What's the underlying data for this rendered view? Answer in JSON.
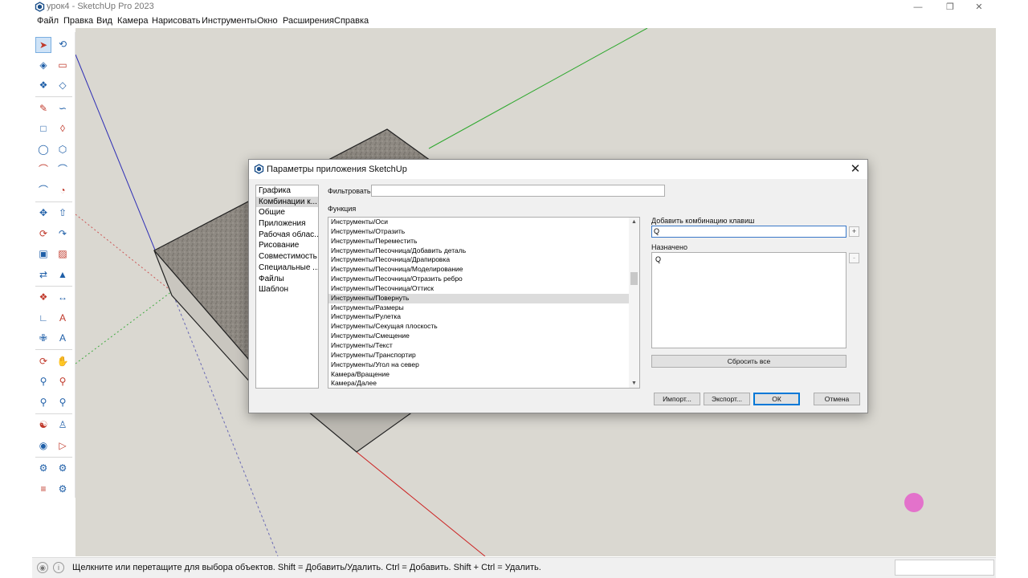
{
  "window": {
    "title": "урок4 - SketchUp Pro 2023",
    "icon": "sketchup-logo-icon",
    "controls": [
      "minimize-icon",
      "restore-icon",
      "close-icon"
    ]
  },
  "menu": [
    "Файл",
    "Правка",
    "Вид",
    "Камера",
    "Нарисовать",
    "Инструменты",
    "Окно",
    "Расширения",
    "Справка"
  ],
  "toolbar": {
    "tools": [
      "select-icon",
      "lasso-icon",
      "paint-bucket-icon",
      "eraser-icon",
      "make-component-icon",
      "tag-icon",
      "pencil-icon",
      "freehand-icon",
      "rectangle-icon",
      "rotated-rectangle-icon",
      "circle-icon",
      "polygon-icon",
      "arc-icon",
      "two-point-arc-icon",
      "three-point-arc-icon",
      "pie-icon",
      "move-icon",
      "push-pull-icon",
      "rotate-icon",
      "follow-me-icon",
      "scale-icon",
      "offset-icon",
      "flip-icon",
      "solid-tools-icon",
      "tape-measure-icon",
      "dimension-icon",
      "protractor-icon",
      "text-icon",
      "axes-icon",
      "3d-text-icon",
      "orbit-icon",
      "pan-icon",
      "zoom-icon",
      "zoom-window-icon",
      "zoom-extents-icon",
      "previous-view-icon",
      "position-camera-icon",
      "walk-icon",
      "look-around-icon",
      "section-plane-icon",
      "warehouse-icon",
      "extension-warehouse-icon",
      "layout-icon",
      "extension-manager-icon"
    ]
  },
  "status": {
    "hint": "Щелкните или перетащите для выбора объектов. Shift = Добавить/Удалить. Ctrl = Добавить. Shift + Ctrl = Удалить."
  },
  "dialog": {
    "title": "Параметры приложения SketchUp",
    "categories": [
      "Графика",
      "Комбинации к...",
      "Общие",
      "Приложения",
      "Рабочая облас...",
      "Рисование",
      "Совместимость",
      "Специальные ...",
      "Файлы",
      "Шаблон"
    ],
    "selected_category": "Комбинации к...",
    "filter_label": "Фильтровать",
    "filter_value": "",
    "function_label": "Функция",
    "functions": [
      "Инструменты/Оси",
      "Инструменты/Отразить",
      "Инструменты/Переместить",
      "Инструменты/Песочница/Добавить деталь",
      "Инструменты/Песочница/Драпировка",
      "Инструменты/Песочница/Моделирование",
      "Инструменты/Песочница/Отразить ребро",
      "Инструменты/Песочница/Оттиск",
      "Инструменты/Повернуть",
      "Инструменты/Размеры",
      "Инструменты/Рулетка",
      "Инструменты/Секущая плоскость",
      "Инструменты/Смещение",
      "Инструменты/Текст",
      "Инструменты/Транспортир",
      "Инструменты/Угол на север",
      "Камера/Вращение",
      "Камера/Далее"
    ],
    "selected_function": "Инструменты/Повернуть",
    "add_shortcut_label": "Добавить комбинацию клавиш",
    "add_shortcut_value": "Q",
    "add_button": "+",
    "assigned_label": "Назначено",
    "assigned": [
      "Q"
    ],
    "remove_button": "-",
    "reset_all": "Сбросить все",
    "import": "Импорт...",
    "export": "Экспорт...",
    "ok": "ОК",
    "cancel": "Отмена"
  }
}
